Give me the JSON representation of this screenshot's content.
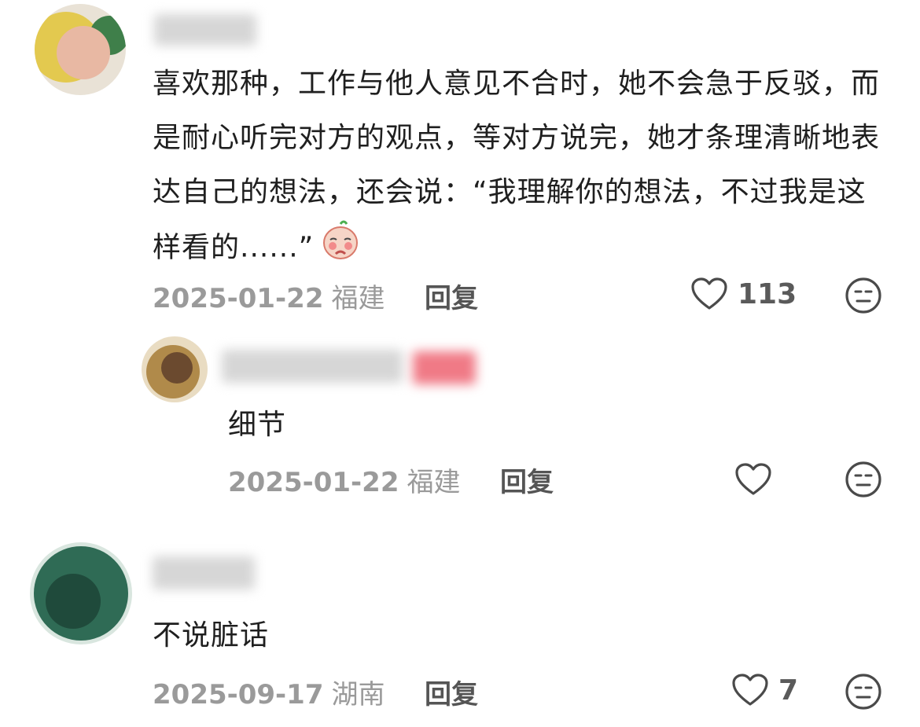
{
  "comments": [
    {
      "text": "喜欢那种，工作与他人意见不合时，她不会急于反驳，而是耐心听完对方的观点，等对方说完，她才条理清晰地表达自己的想法，还会说：“我理解你的想法，不过我是这样看的......”",
      "emoji": "shy-bun-emoji",
      "date": "2025-01-22",
      "location": "福建",
      "reply_label": "回复",
      "likes": "113"
    },
    {
      "text": "细节",
      "date": "2025-01-22",
      "location": "福建",
      "reply_label": "回复",
      "likes": ""
    },
    {
      "text": "不说脏话",
      "date": "2025-09-17",
      "location": "湖南",
      "reply_label": "回复",
      "likes": "7"
    }
  ],
  "icons": {
    "like": "heart-outline-icon",
    "dislike": "meh-face-icon"
  },
  "colors": {
    "text": "#1f1f1f",
    "meta": "#9a9a9a",
    "icon": "#4a4a4a"
  }
}
